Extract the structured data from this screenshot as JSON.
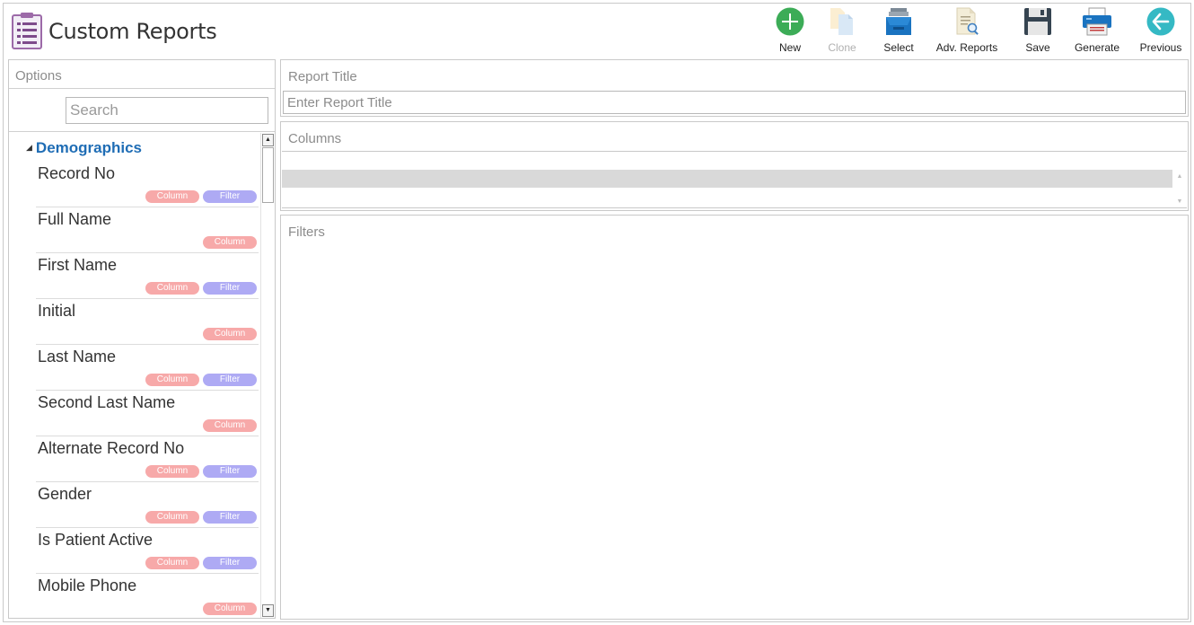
{
  "app": {
    "title": "Custom Reports"
  },
  "toolbar": {
    "new_label": "New",
    "clone_label": "Clone",
    "select_label": "Select",
    "adv_reports_label": "Adv. Reports",
    "save_label": "Save",
    "generate_label": "Generate",
    "previous_label": "Previous",
    "clone_disabled": true
  },
  "options": {
    "heading": "Options",
    "search_placeholder": "Search",
    "group": "Demographics",
    "column_tag": "Column",
    "filter_tag": "Filter",
    "fields": [
      {
        "label": "Record No",
        "column": true,
        "filter": true
      },
      {
        "label": "Full Name",
        "column": true,
        "filter": false
      },
      {
        "label": "First Name",
        "column": true,
        "filter": true
      },
      {
        "label": "Initial",
        "column": true,
        "filter": false
      },
      {
        "label": "Last Name",
        "column": true,
        "filter": true
      },
      {
        "label": "Second Last Name",
        "column": true,
        "filter": false
      },
      {
        "label": "Alternate Record No",
        "column": true,
        "filter": true
      },
      {
        "label": "Gender",
        "column": true,
        "filter": true
      },
      {
        "label": "Is Patient Active",
        "column": true,
        "filter": true
      },
      {
        "label": "Mobile Phone",
        "column": true,
        "filter": false
      }
    ]
  },
  "report_title": {
    "heading": "Report Title",
    "placeholder": "Enter Report Title",
    "value": ""
  },
  "columns": {
    "heading": "Columns"
  },
  "filters": {
    "heading": "Filters"
  },
  "colors": {
    "group_header": "#1f6db5",
    "column_tag": "#f7a9a9",
    "filter_tag": "#aeaaf4",
    "new_icon": "#3cac57",
    "previous_icon": "#35b9c4",
    "select_icon": "#1a73c0"
  }
}
